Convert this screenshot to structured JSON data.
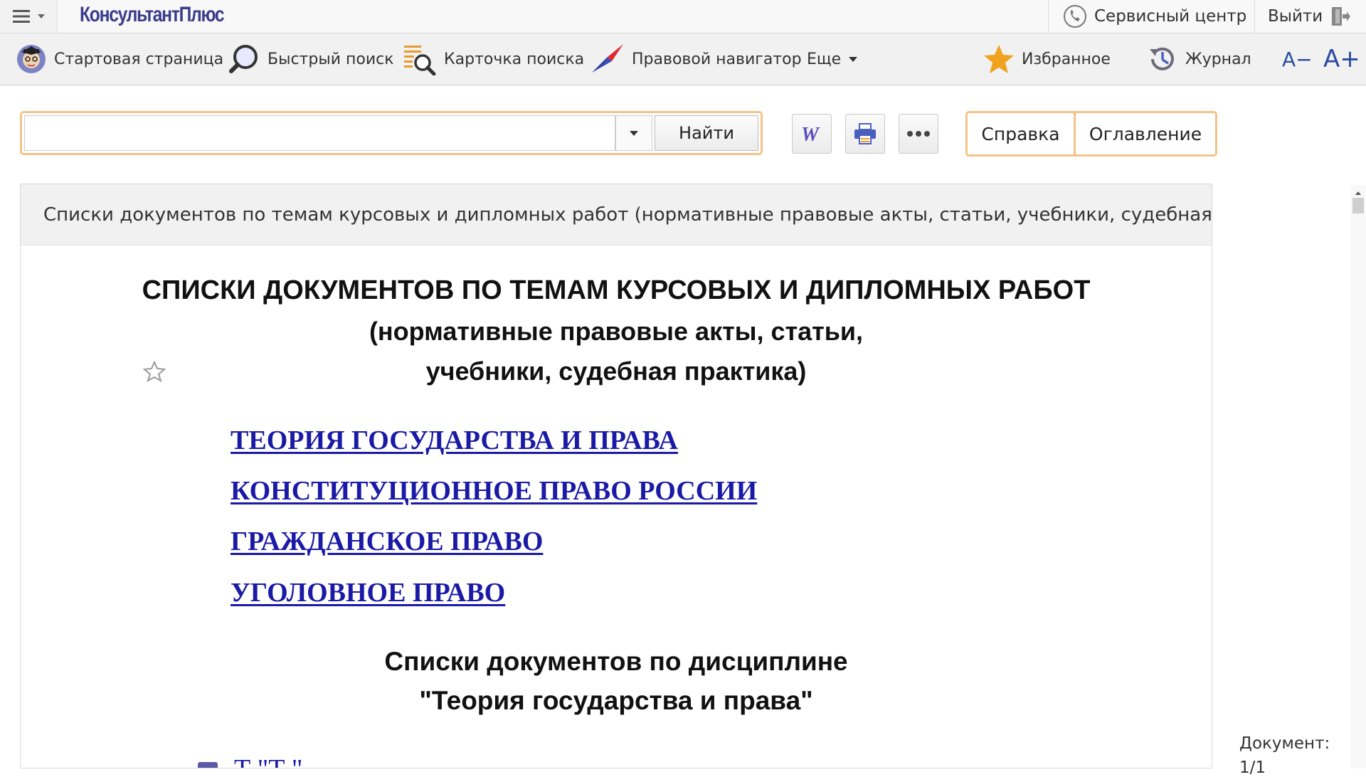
{
  "app": {
    "logo": "КонсультантПлюс",
    "service_center": "Сервисный центр",
    "logout": "Выйти"
  },
  "toolbar": {
    "start_page": "Стартовая страница",
    "quick_search": "Быстрый поиск",
    "search_card": "Карточка поиска",
    "legal_navigator": "Правовой навигатор",
    "more": "Еще",
    "favorites": "Избранное",
    "journal": "Журнал",
    "font_decrease": "A−",
    "font_increase": "A+"
  },
  "search": {
    "value": "",
    "button": "Найти"
  },
  "doc_actions": {
    "help": "Справка",
    "contents": "Оглавление"
  },
  "document": {
    "header": "Списки документов по темам курсовых и дипломных работ (нормативные правовые акты, статьи, учебники, судебная практик",
    "title_line1": "СПИСКИ ДОКУМЕНТОВ ПО ТЕМАМ КУРСОВЫХ И ДИПЛОМНЫХ РАБОТ",
    "title_line2": "(нормативные правовые акты, статьи,",
    "title_line3": "учебники, судебная практика)",
    "links": [
      "ТЕОРИЯ ГОСУДАРСТВА И ПРАВА",
      "КОНСТИТУЦИОННОЕ ПРАВО РОССИИ",
      "ГРАЖДАНСКОЕ ПРАВО",
      "УГОЛОВНОЕ ПРАВО"
    ],
    "subtitle_line1": "Списки документов по дисциплине",
    "subtitle_line2": "\"Теория государства и права\"",
    "partial_line": "Т                          \"Т                              \""
  },
  "status": {
    "doc_label": "Документ:",
    "doc_value": "1/1"
  },
  "colors": {
    "accent_orange": "#f3c48a",
    "link_blue": "#1a1aa6",
    "logo_blue": "#3b3c8c"
  }
}
